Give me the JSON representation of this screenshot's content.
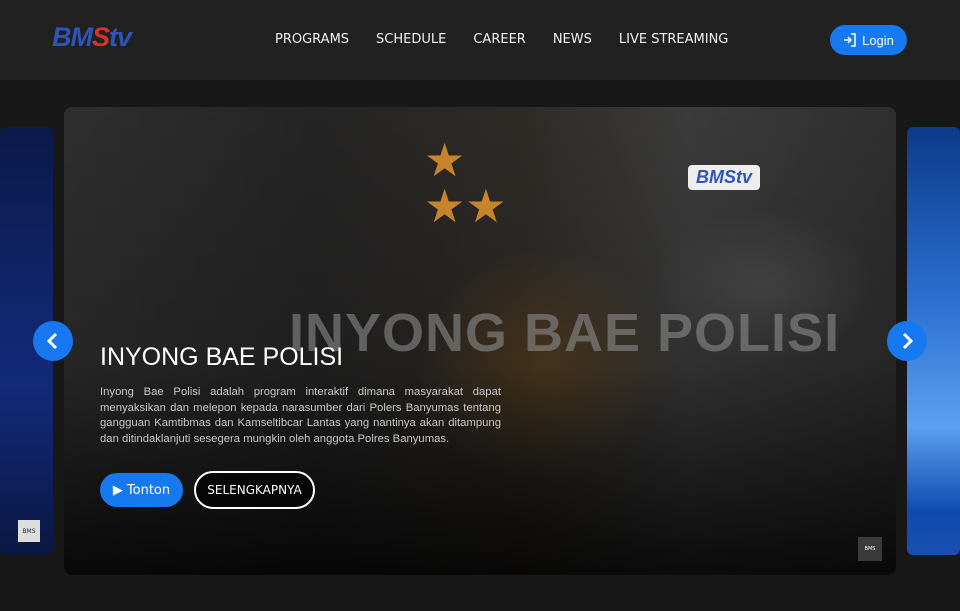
{
  "header": {
    "logo": "BMStv",
    "nav": [
      "PROGRAMS",
      "SCHEDULE",
      "CAREER",
      "NEWS",
      "LIVE STREAMING"
    ],
    "login_label": "Login"
  },
  "slide": {
    "title": "INYONG BAE POLISI",
    "watermark": "INYONG BAE POLISI",
    "description": "Inyong Bae Polisi adalah program interaktif dimana masyarakat dapat menyaksikan dan melepon kepada narasumber dari Polers Banyumas tentang gangguan Kamtibmas dan Kamseltibcar Lantas yang nantinya akan ditampung dan ditindaklanjuti sesegera mungkin oleh anggota Polres Banyumas.",
    "badge": "BMStv",
    "watch_label": "Tonton",
    "more_label": "SELENGKAPNYA"
  },
  "colors": {
    "accent": "#1779f0",
    "header_bg": "#212121",
    "page_bg": "#181818"
  }
}
